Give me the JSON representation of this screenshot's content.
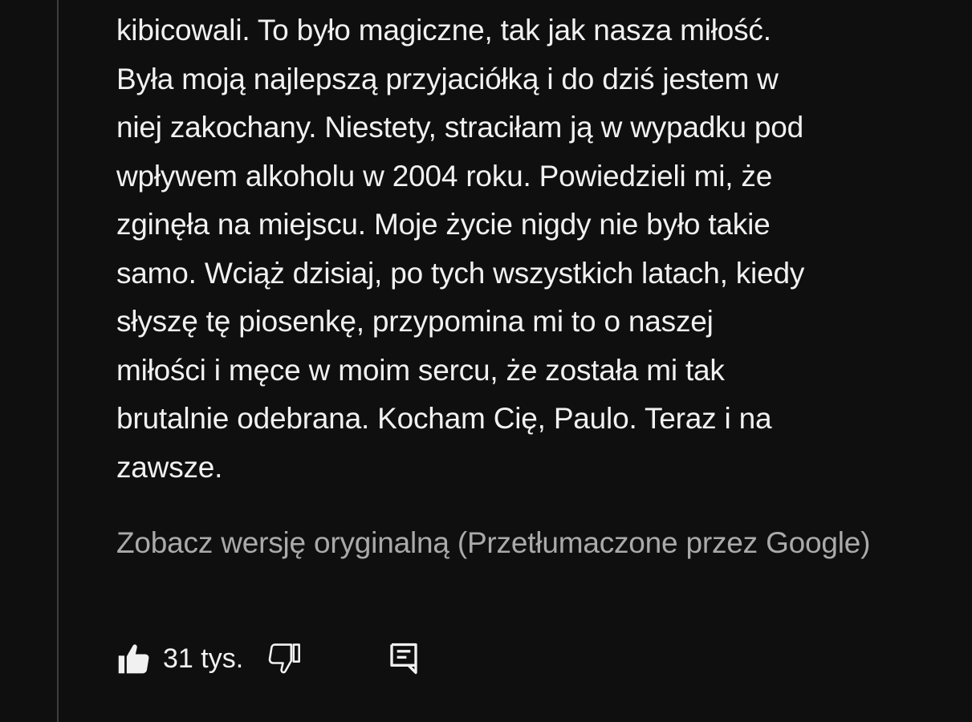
{
  "comment": {
    "lines": [
      "kibicowali. To było magiczne, tak jak nasza miłość.",
      "Była moją najlepszą przyjaciółką i do dziś jestem w",
      "niej zakochany. Niestety, straciłam ją w wypadku pod",
      "wpływem alkoholu w 2004 roku. Powiedzieli mi, że",
      "zginęła na miejscu. Moje życie nigdy nie było takie",
      "samo. Wciąż dzisiaj, po tych wszystkich latach, kiedy",
      "słyszę tę piosenkę, przypomina mi to o naszej",
      "miłości i męce w moim sercu, że została mi tak",
      "brutalnie odebrana. Kocham Cię, Paulo. Teraz i na",
      "zawsze."
    ],
    "translation_link": "Zobacz wersję oryginalną (Przetłumaczone przez Google)"
  },
  "actions": {
    "like_icon": "thumbs-up-filled-icon",
    "like_count": "31 tys.",
    "dislike_icon": "thumbs-down-outline-icon",
    "reply_icon": "reply-comment-icon"
  },
  "colors": {
    "background": "#0f0f0f",
    "text": "#f1f1f1",
    "secondary_text": "#aaaaaa"
  }
}
